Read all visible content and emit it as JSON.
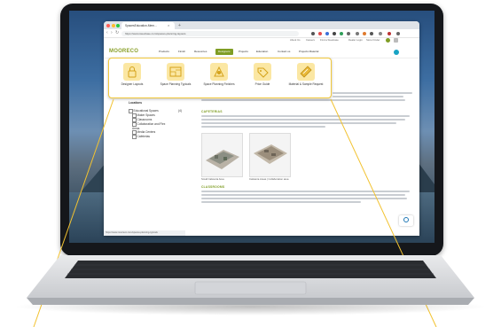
{
  "browser": {
    "tab_title": "SpacesEducation-Mem...",
    "url": "https://www.steelcase.com/spaces-planning-layouts",
    "tab_close_glyph": "×",
    "new_tab_glyph": "+",
    "nav_glyphs": [
      "‹",
      "›",
      "↻"
    ]
  },
  "util_links": [
    "About Us",
    "Careers",
    "Find a Steelcase",
    "Dealer Login",
    "Store Finder"
  ],
  "nav": {
    "logo_text": "MOORECO",
    "items": [
      "Products",
      "Finish",
      "Resources",
      "Designers",
      "Projects",
      "Education",
      "Contact us",
      "Projects Material"
    ],
    "active_index": 3
  },
  "mega_menu": {
    "items": [
      {
        "label": "Designer Layouts",
        "icon": "lock-icon"
      },
      {
        "label": "Space Planning Typicals",
        "icon": "blueprint-icon"
      },
      {
        "label": "Space Planning Finishes",
        "icon": "finishes-icon"
      },
      {
        "label": "Price Guide",
        "icon": "price-tag-icon"
      },
      {
        "label": "Material & Sample Request",
        "icon": "samples-icon"
      }
    ]
  },
  "sidebar": {
    "locations_label": "Locations",
    "group_label": "Educational Spaces",
    "group_count": "(4)",
    "items": [
      "Maker Spaces",
      "Classrooms",
      "Collaboration and Flex Areas",
      "Media Centers",
      "Cafeterias"
    ]
  },
  "sections": {
    "cafeterias_heading": "CAFETERIAS",
    "thumb_captions": [
      "Small Cafeteria Area",
      "Cafeteria Areas | Collaboration area"
    ],
    "classrooms_heading": "CLASSROOMS"
  },
  "statusbar_text": "https://www.mooreco.com/spaces-planning-typicals",
  "colors": {
    "accent": "#7f9d24",
    "highlight": "#f1c83a",
    "help": "#18a3c4"
  }
}
